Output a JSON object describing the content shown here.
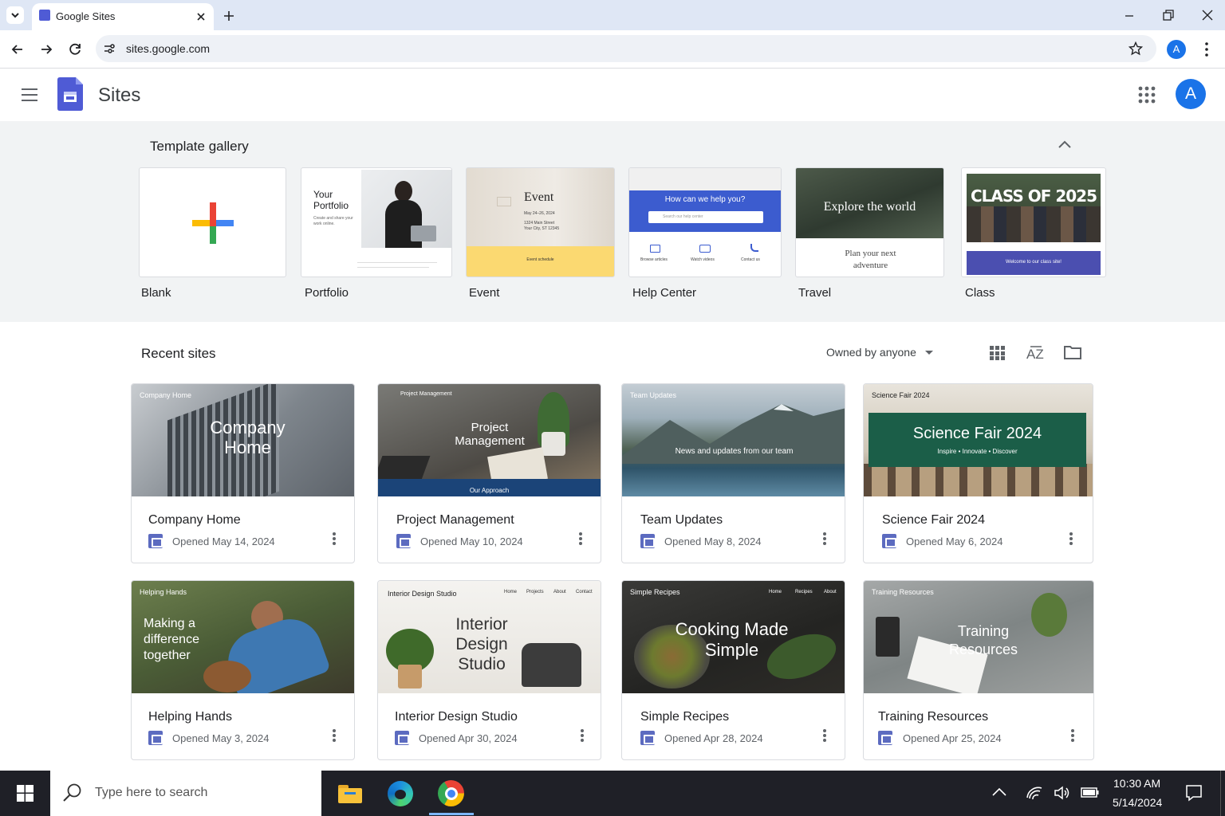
{
  "browser": {
    "tab_title": "Google Sites",
    "url": "sites.google.com",
    "profile_initial": "A"
  },
  "app": {
    "title": "Sites",
    "avatar_initial": "A"
  },
  "gallery": {
    "title": "Template gallery",
    "templates": [
      {
        "label": "Blank"
      },
      {
        "label": "Portfolio",
        "thumb_title": "Your Portfolio",
        "thumb_sub": "Create and share your work online."
      },
      {
        "label": "Event",
        "thumb_title": "Event",
        "thumb_date": "May 24–26, 2024",
        "thumb_addr1": "1324 Main Street",
        "thumb_addr2": "Your City, ST 12345",
        "thumb_footer": "Event schedule"
      },
      {
        "label": "Help Center",
        "thumb_title": "How can we help you?",
        "thumb_search": "Search our help center",
        "thumb_links": [
          "Browse articles",
          "Watch videos",
          "Contact us"
        ]
      },
      {
        "label": "Travel",
        "thumb_title": "Explore the world",
        "thumb_sub": "Plan your next adventure"
      },
      {
        "label": "Class",
        "thumb_title": "CLASS OF 2025",
        "thumb_footer": "Welcome to our class site!"
      }
    ]
  },
  "recent": {
    "title": "Recent sites",
    "owner_filter": "Owned by anyone",
    "sites": [
      {
        "name": "Company Home",
        "opened": "Opened May 14, 2024",
        "thumb_small": "Company Home",
        "thumb_big": "Company Home"
      },
      {
        "name": "Project Management",
        "opened": "Opened May 10, 2024",
        "thumb_small": "Project Management",
        "thumb_big": "Project Management",
        "thumb_footer": "Our Approach"
      },
      {
        "name": "Team Updates",
        "opened": "Opened May 8, 2024",
        "thumb_small": "Team Updates",
        "thumb_big": "News and updates from our team"
      },
      {
        "name": "Science Fair 2024",
        "opened": "Opened May 6, 2024",
        "thumb_small": "Science Fair 2024",
        "thumb_big": "Science Fair 2024",
        "thumb_sub": "Inspire • Innovate • Discover"
      },
      {
        "name": "Helping Hands",
        "opened": "Opened May 3, 2024",
        "thumb_small": "Helping Hands",
        "thumb_big": "Making a difference together"
      },
      {
        "name": "Interior Design Studio",
        "opened": "Opened Apr 30, 2024",
        "thumb_small": "Interior Design Studio",
        "thumb_big": "Interior Design Studio",
        "thumb_nav": [
          "Home",
          "Projects",
          "About",
          "Contact"
        ]
      },
      {
        "name": "Simple Recipes",
        "opened": "Opened Apr 28, 2024",
        "thumb_small": "Simple Recipes",
        "thumb_big": "Cooking Made Simple",
        "thumb_nav": [
          "Home",
          "Recipes",
          "About"
        ]
      },
      {
        "name": "Training Resources",
        "opened": "Opened Apr 25, 2024",
        "thumb_small": "Training Resources",
        "thumb_big": "Training Resources"
      }
    ]
  },
  "taskbar": {
    "search_placeholder": "Type here to search",
    "time": "10:30 AM",
    "date": "5/14/2024"
  },
  "colors": {
    "brand": "#4f5bd5",
    "avatar": "#1a73e8",
    "taskbar": "#1f2027"
  }
}
